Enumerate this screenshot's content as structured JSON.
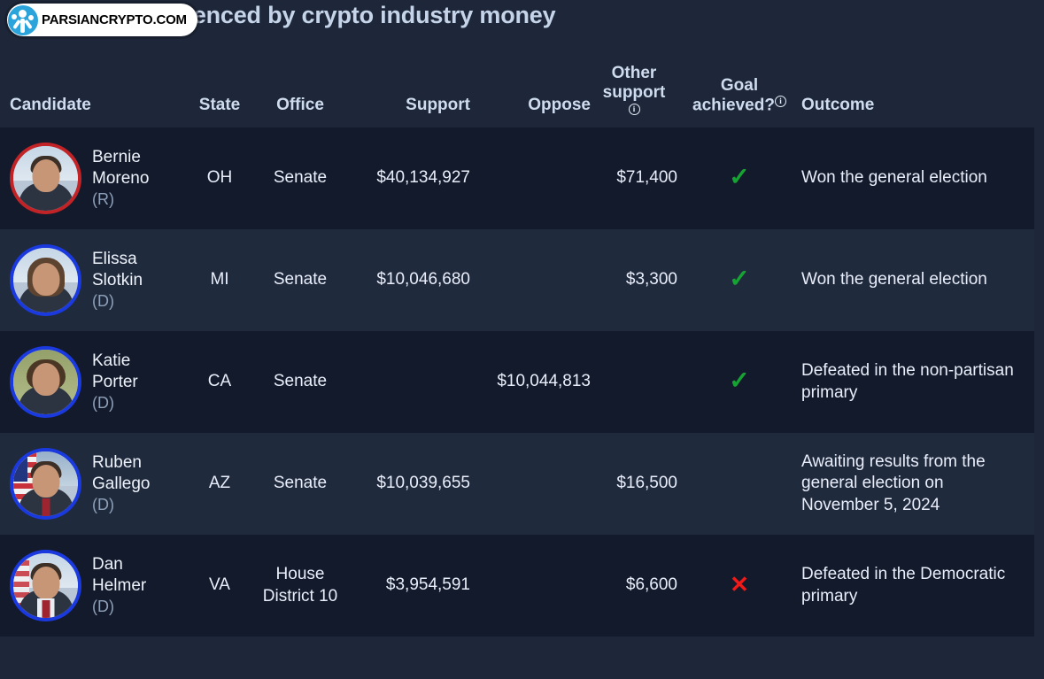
{
  "page": {
    "title": "Candidates influenced by crypto industry money",
    "background_color": "#1d2739",
    "row_color_odd": "#121a2b",
    "row_color_even": "#1f2a3d",
    "accent_democrat": "#1a3ae0",
    "accent_republican": "#c22327",
    "check_color": "#17a333",
    "cross_color": "#f21919"
  },
  "watermark": {
    "text": "PARSIANCRYPTO.COM",
    "logo_icon": "tree-circle-logo-icon"
  },
  "table": {
    "columns": [
      {
        "key": "candidate",
        "label": "Candidate",
        "info": false
      },
      {
        "key": "state",
        "label": "State",
        "info": false
      },
      {
        "key": "office",
        "label": "Office",
        "info": false
      },
      {
        "key": "support",
        "label": "Support",
        "info": false
      },
      {
        "key": "oppose",
        "label": "Oppose",
        "info": false
      },
      {
        "key": "other_support",
        "label": "Other support",
        "info": true,
        "info_icon": "info-icon"
      },
      {
        "key": "goal_achieved",
        "label": "Goal achieved?",
        "info": true,
        "info_icon": "info-icon"
      },
      {
        "key": "outcome",
        "label": "Outcome",
        "info": false
      }
    ],
    "rows": [
      {
        "first_name": "Bernie",
        "last_name": "Moreno",
        "party": "(R)",
        "state": "OH",
        "office": "Senate",
        "support": "$40,134,927",
        "oppose": "",
        "other_support": "$71,400",
        "goal_achieved": "check",
        "goal_glyph": "✓",
        "outcome": "Won the general election"
      },
      {
        "first_name": "Elissa",
        "last_name": "Slotkin",
        "party": "(D)",
        "state": "MI",
        "office": "Senate",
        "support": "$10,046,680",
        "oppose": "",
        "other_support": "$3,300",
        "goal_achieved": "check",
        "goal_glyph": "✓",
        "outcome": "Won the general election"
      },
      {
        "first_name": "Katie",
        "last_name": "Porter",
        "party": "(D)",
        "state": "CA",
        "office": "Senate",
        "support": "",
        "oppose": "$10,044,813",
        "other_support": "",
        "goal_achieved": "check",
        "goal_glyph": "✓",
        "outcome": "Defeated in the non-partisan primary"
      },
      {
        "first_name": "Ruben",
        "last_name": "Gallego",
        "party": "(D)",
        "state": "AZ",
        "office": "Senate",
        "support": "$10,039,655",
        "oppose": "",
        "other_support": "$16,500",
        "goal_achieved": "none",
        "goal_glyph": "",
        "outcome": "Awaiting results from the general election on November 5, 2024"
      },
      {
        "first_name": "Dan",
        "last_name": "Helmer",
        "party": "(D)",
        "state": "VA",
        "office": "House District 10",
        "support": "$3,954,591",
        "oppose": "",
        "other_support": "$6,600",
        "goal_achieved": "cross",
        "goal_glyph": "✕",
        "outcome": "Defeated in the Democratic primary"
      }
    ]
  }
}
